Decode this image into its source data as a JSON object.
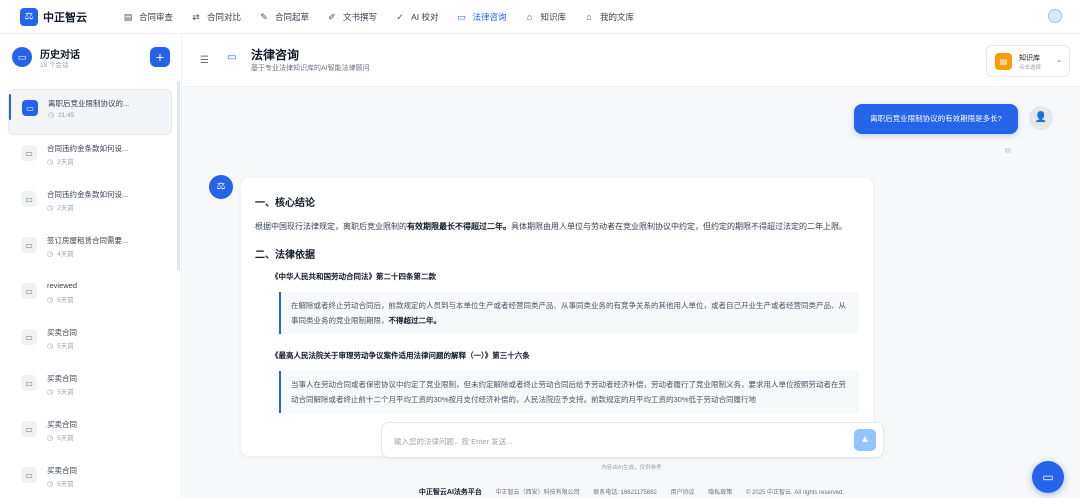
{
  "app": {
    "name": "中正智云",
    "logo": "scale-icon"
  },
  "nav": [
    {
      "label": "合同审查",
      "icon": "doc-search-icon"
    },
    {
      "label": "合同对比",
      "icon": "swap-icon"
    },
    {
      "label": "合同起草",
      "icon": "edit-icon"
    },
    {
      "label": "文书撰写",
      "icon": "pen-icon"
    },
    {
      "label": "AI 校对",
      "icon": "check-circle-icon"
    },
    {
      "label": "法律咨询",
      "icon": "chat-icon",
      "active": true
    },
    {
      "label": "知识库",
      "icon": "library-icon"
    },
    {
      "label": "我的文库",
      "icon": "folder-icon"
    }
  ],
  "sidebar": {
    "title": "历史对话",
    "count": "18 个会话",
    "items": [
      {
        "title": "离职后竞业限制协议的...",
        "time": "21:45",
        "active": true
      },
      {
        "title": "合同违约金条款如何设...",
        "time": "2天前"
      },
      {
        "title": "合同违约金条款如何设...",
        "time": "2天前"
      },
      {
        "title": "签订房屋租赁合同需要...",
        "time": "4天前"
      },
      {
        "title": "reviewed",
        "time": "5天前"
      },
      {
        "title": "买卖合同",
        "time": "5天前"
      },
      {
        "title": "买卖合同",
        "time": "5天前"
      },
      {
        "title": "买卖合同",
        "time": "5天前"
      },
      {
        "title": "买卖合同",
        "time": "5天前"
      }
    ]
  },
  "header": {
    "title": "法律咨询",
    "subtitle": "基于专业法律知识库的AI智能法律顾问",
    "kb_title": "知识库",
    "kb_sub": "点击选择"
  },
  "chat": {
    "user_question": "离职后竞业限制协议的有效期限是多长?",
    "answer": {
      "h1": "一、核心结论",
      "p1_a": "根据中国现行法律规定，离职后竞业限制的",
      "p1_b": "有效期限最长不得超过二年。",
      "p1_c": "具体期限由用人单位与劳动者在竞业限制协议中约定，但约定的期限不得超过法定的二年上限。",
      "h2": "二、法律依据",
      "law1": "《中华人民共和国劳动合同法》第二十四条第二款",
      "q1_a": "在解除或者终止劳动合同后，前款规定的人员到与本单位生产或者经营同类产品、从事同类业务的有竞争关系的其他用人单位，或者自己开业生产或者经营同类产品、从事同类业务的竞业限制期限，",
      "q1_b": "不得超过二年。",
      "law2": "《最高人民法院关于审理劳动争议案件适用法律问题的解释（一）》第三十六条",
      "q2": "当事人在劳动合同或者保密协议中约定了竞业限制，但未约定解除或者终止劳动合同后给予劳动者经济补偿，劳动者履行了竞业限制义务，要求用人单位按照劳动者在劳动合同解除或者终止前十二个月平均工资的30%按月支付经济补偿的，人民法院应予支持。前款规定的月平均工资的30%低于劳动合同履行地"
    }
  },
  "input": {
    "placeholder": "输入您的法律问题，按 Enter 发送..."
  },
  "ai_note": "内容由AI生成，仅供参考",
  "footer": {
    "brand": "中正智云AI法务平台",
    "company": "中正智云（西安）科技有限公司",
    "phone": "联系电话: 16621175882",
    "agreement": "用户协议",
    "privacy": "隐私政策",
    "copyright": "© 2025 中正智云. All rights reserved."
  },
  "colors": {
    "accent": "#2563eb",
    "kb_badge": "#f59e0b"
  }
}
